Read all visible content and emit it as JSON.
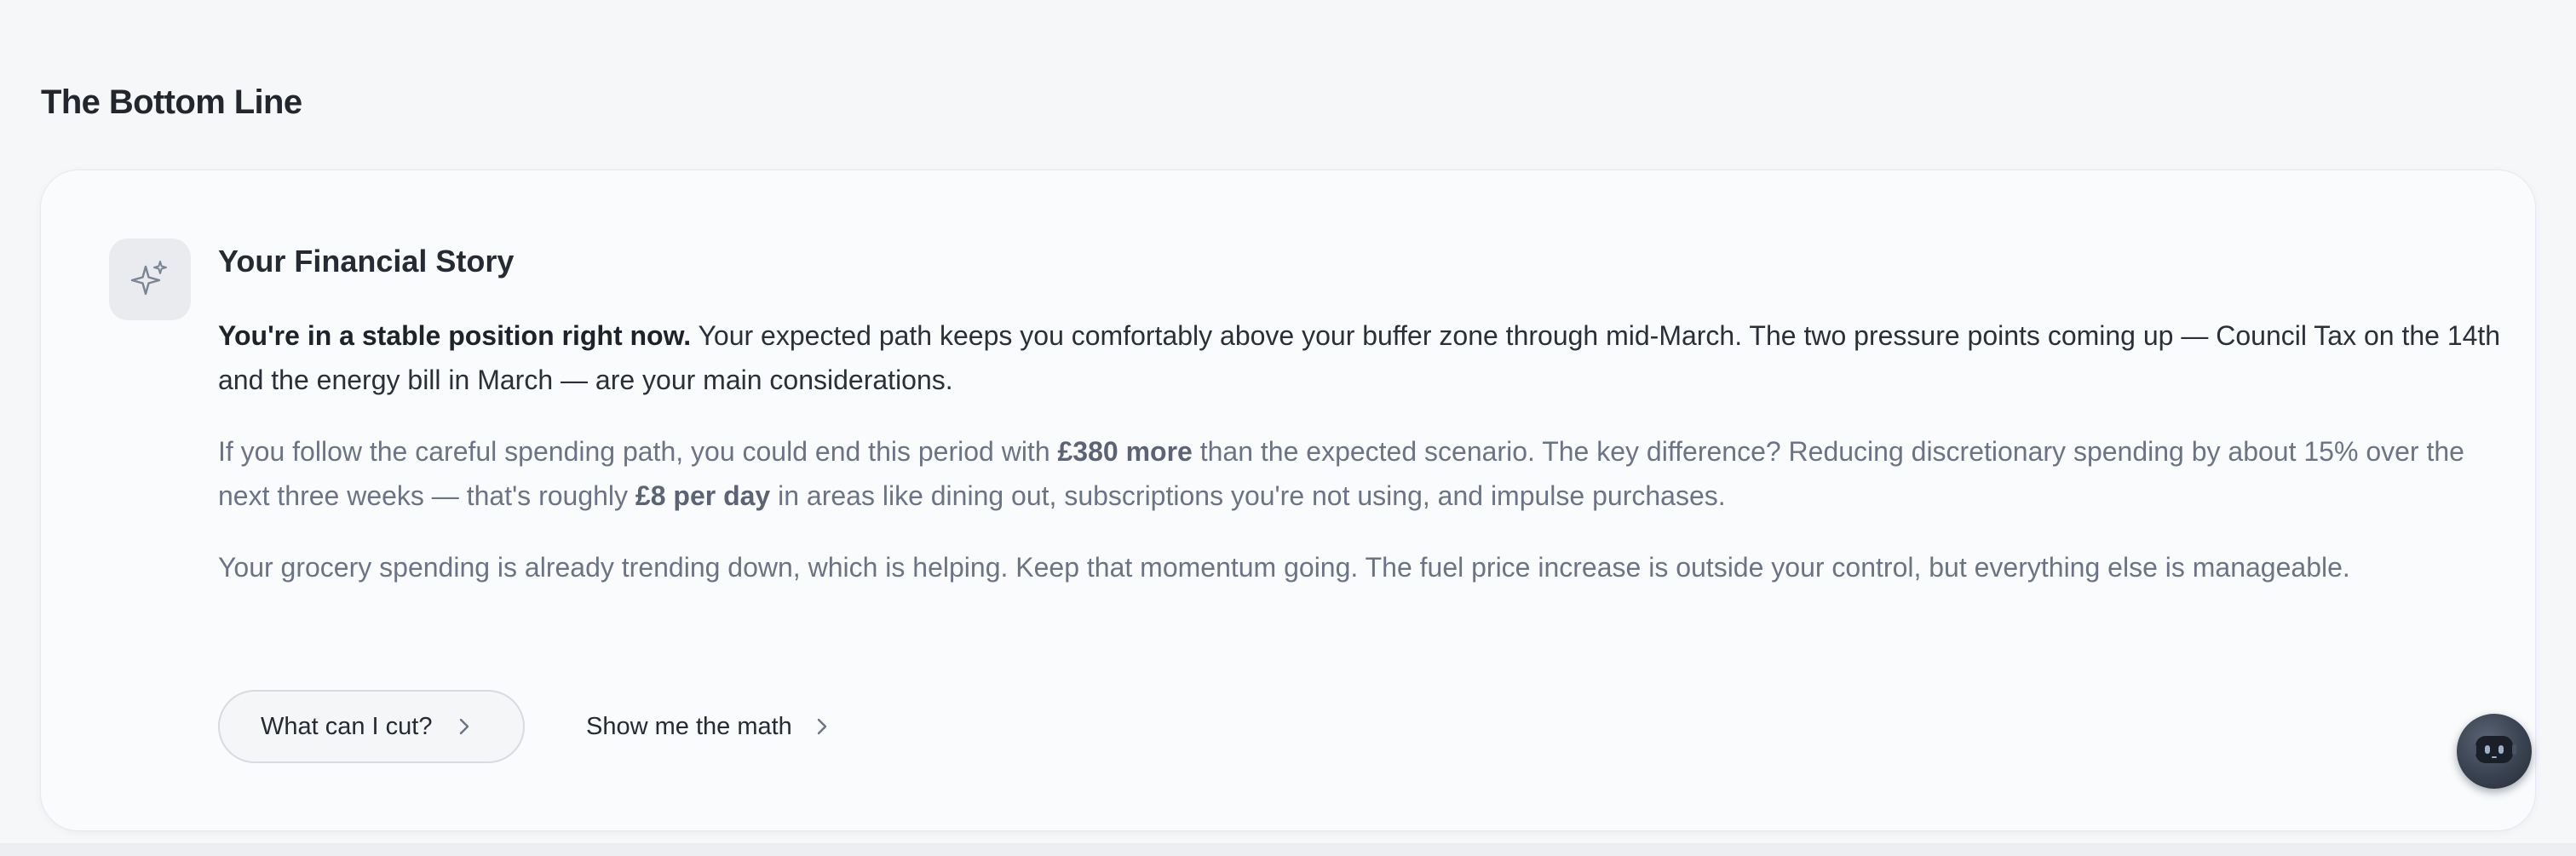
{
  "section": {
    "title": "The Bottom Line"
  },
  "story": {
    "icon": "sparkle-icon",
    "title": "Your Financial Story",
    "paragraph1": {
      "lead_bold": "You're in a stable position right now.",
      "text": " Your expected path keeps you comfortably above your buffer zone through mid-March. The two pressure points coming up — Council Tax on the 14th and the energy bill in March — are your main considerations."
    },
    "paragraph2": {
      "part1": "If you follow the careful spending path, you could end this period with ",
      "bold1": "£380 more",
      "part2": " than the expected scenario. The key difference? Reducing discretionary spending by about 15% over the next three weeks — that's roughly ",
      "bold2": "£8 per day",
      "part3": " in areas like dining out, subscriptions you're not using, and impulse purchases."
    },
    "paragraph3": {
      "text": "Your grocery spending is already trending down, which is helping. Keep that momentum going. The fuel price increase is outside your control, but everything else is manageable."
    }
  },
  "actions": {
    "cut_label": "What can I cut?",
    "math_label": "Show me the math"
  },
  "assistant": {
    "icon": "robot-icon"
  },
  "colors": {
    "page_background": "#f6f7f9",
    "card_background": "#f9fbfc",
    "heading_text": "#23262d",
    "muted_text": "#6b7385",
    "assistant_button": "#394250"
  }
}
